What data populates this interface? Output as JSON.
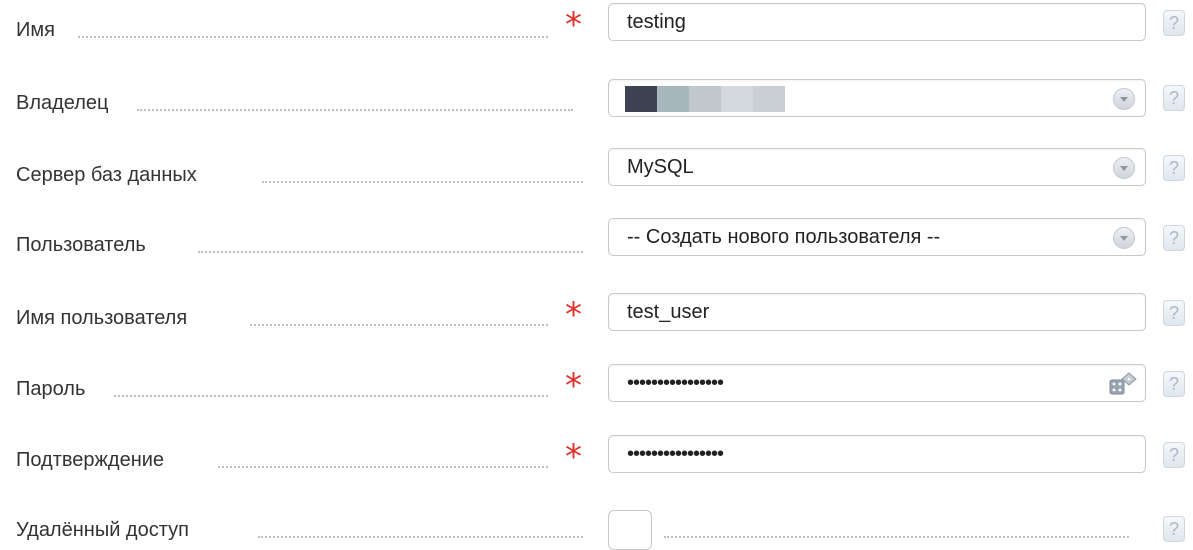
{
  "form": {
    "name": {
      "label": "Имя",
      "value": "testing",
      "required": true
    },
    "owner": {
      "label": "Владелец",
      "swatches": [
        "#3d4352",
        "#a8b6be",
        "#c0c8cc",
        "#d3d8dc",
        "#c9cfd3"
      ]
    },
    "db_server": {
      "label": "Сервер баз данных",
      "value": "MySQL"
    },
    "user": {
      "label": "Пользователь",
      "value": "-- Создать нового пользователя --"
    },
    "username": {
      "label": "Имя пользователя",
      "value": "test_user",
      "required": true
    },
    "password": {
      "label": "Пароль",
      "value": "••••••••••••••••",
      "required": true
    },
    "confirm": {
      "label": "Подтверждение",
      "value": "••••••••••••••••",
      "required": true
    },
    "remote_access": {
      "label": "Удалённый доступ",
      "checked": false
    }
  },
  "required_mark": "*",
  "help_mark": "?"
}
